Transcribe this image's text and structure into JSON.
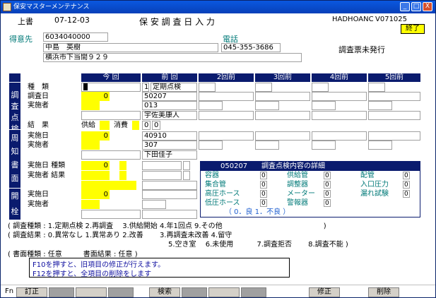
{
  "window": {
    "title": "保安マスターメンテナンス",
    "controls": [
      "_",
      "□",
      "X"
    ]
  },
  "header": {
    "mode": "上書",
    "date": "07-12-03",
    "screen_title": "保 安 調 査 日 入 力",
    "user": "HADHOANC",
    "version": "V071025",
    "exit_button": "終了"
  },
  "customer": {
    "label": "得意先",
    "code": "6034040000",
    "name": "中島　英樹",
    "address": "横浜市下当間９２９",
    "phone_label": "電話",
    "phone": "045-355-3686",
    "status": "調査票未発行"
  },
  "columns": [
    "今 回",
    "前 回",
    "2回前",
    "3回前",
    "4回前",
    "5回前"
  ],
  "side_labels": {
    "chousa": [
      "調",
      "査",
      "点",
      "検"
    ],
    "shuchi": [
      "周",
      "知",
      "書",
      "面"
    ],
    "kaisen": [
      "開",
      "栓"
    ]
  },
  "rows": {
    "kind_label": "種　類",
    "date_label": "調査日",
    "person_label": "実施者",
    "result_label": "結　果",
    "supply_label": "供給",
    "consume_label": "消費",
    "kind_prev_num": "1",
    "kind_prev_text": "定期点検",
    "date_now": "0",
    "date_prev": "50207",
    "person_prev": "013",
    "person_prev_name": "宇佐美康人",
    "result_prev_a": "0",
    "result_prev_b": "0",
    "s_date_label": "実施日",
    "s_person_label": "実施者",
    "s_date_now": "0",
    "s_date_prev": "40910",
    "s_person_prev": "307",
    "s_person_prev_name": "下田佳子",
    "s_kind_label": "実施日 種類",
    "s_result_label": "実施者 結果",
    "s_kind_now": "0",
    "k_date_label": "実施日",
    "k_person_label": "実施者",
    "k_date_now": "0"
  },
  "popup": {
    "title_code": "050207",
    "title": "調査点検内容の詳細",
    "items": [
      {
        "label": "容器",
        "value": "0"
      },
      {
        "label": "供給管",
        "value": "0"
      },
      {
        "label": "配管",
        "value": "0"
      },
      {
        "label": "集合管",
        "value": "0"
      },
      {
        "label": "調整器",
        "value": "0"
      },
      {
        "label": "入口圧力",
        "value": "0"
      },
      {
        "label": "高圧ホース",
        "value": "0"
      },
      {
        "label": "メーター",
        "value": "0"
      },
      {
        "label": "漏れ試験",
        "value": "0"
      },
      {
        "label": "低圧ホース",
        "value": "0"
      },
      {
        "label": "警報器",
        "value": "0"
      }
    ],
    "legend": "（ 0．良 1．不良 ）"
  },
  "legend": {
    "line1": "( 調査種類 : 1.定期点検 2.再調査　 3.供給開始 4.年1回点 9.その他　　　　　　　　　　　　　　 )",
    "line2": "( 調査結果 : 0.異常なし 1.異常あり 2.改善　　 3.再調査未改善 4.留守",
    "line3": "5.空き室　 6.未使用　　　 7.調査拒否　　 8.調査不能 )",
    "line4": "( 書面種類 : 任意　　　書面結果 : 任意 )"
  },
  "messages": [
    "F10を押すと、旧項目の修正が行えます。",
    "F12を押すと、全項目の削除をします"
  ],
  "fkeys": {
    "fn": "Fn",
    "f1": "訂正",
    "f5": "検索",
    "f9": "修正",
    "f11": "削除"
  }
}
